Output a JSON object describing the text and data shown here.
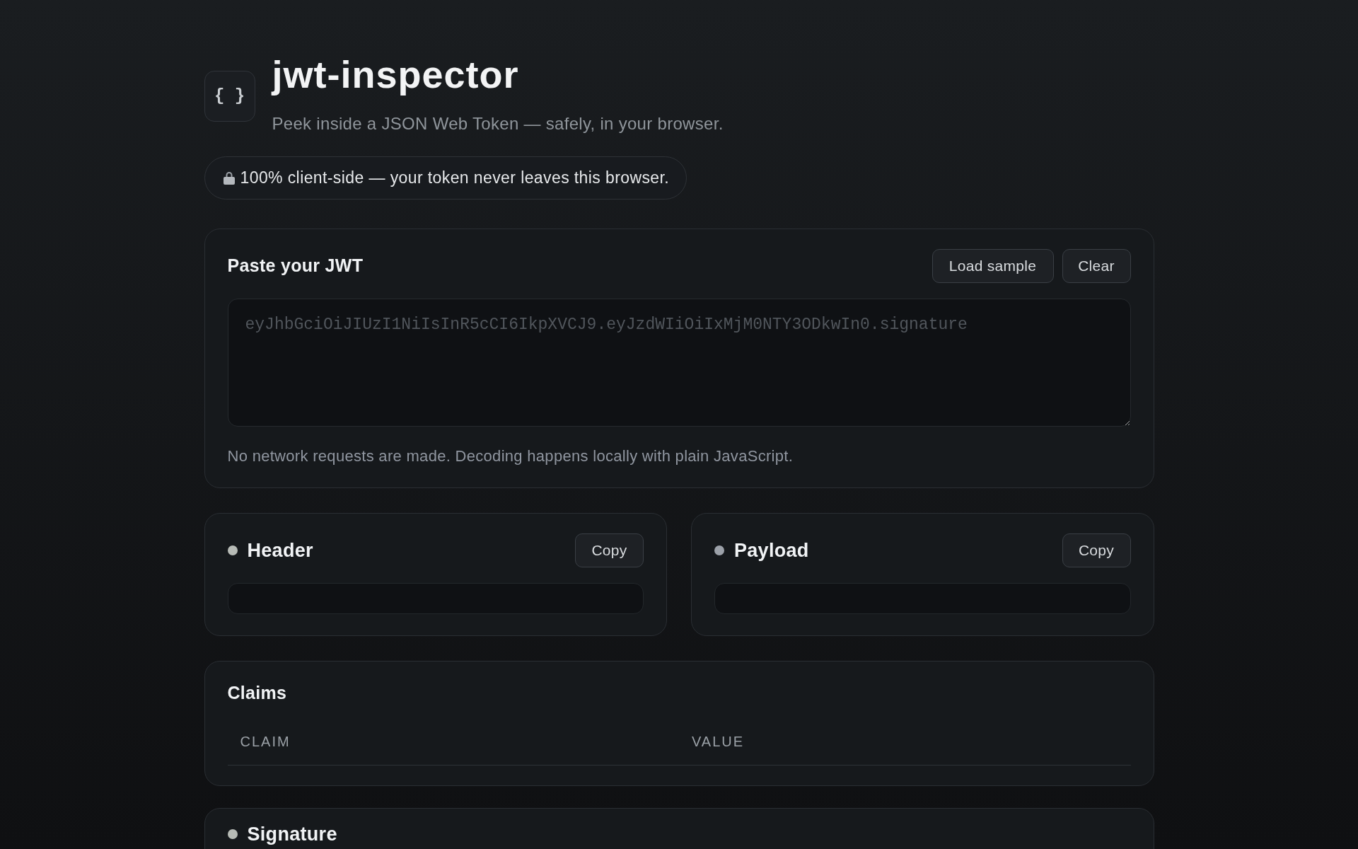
{
  "header": {
    "logo": "{ }",
    "title": "jwt-inspector",
    "subtitle": "Peek inside a JSON Web Token — safely, in your browser."
  },
  "privacy_badge": "100% client-side — your token never leaves this browser.",
  "input_card": {
    "title": "Paste your JWT",
    "buttons": [
      "Load sample",
      "Clear"
    ],
    "token_field": {
      "placeholder": "eyJhbGciOiJIUzI1NiIsInR5cCI6IkpXVCJ9.eyJzdWIiOiIxMjM0NTY3ODkwIn0.signature"
    },
    "note": "No network requests are made. Decoding happens locally with plain JavaScript."
  },
  "sections": [
    {
      "title": "Header",
      "color": "#b7bbb6",
      "button": "Copy"
    },
    {
      "title": "Payload",
      "color": "#9ca1a9",
      "button": "Copy"
    }
  ],
  "claims": {
    "title": "Claims",
    "columns": [
      "CLAIM",
      "VALUE"
    ]
  },
  "signature": {
    "title": "Signature",
    "color": "#b7bbb6"
  }
}
